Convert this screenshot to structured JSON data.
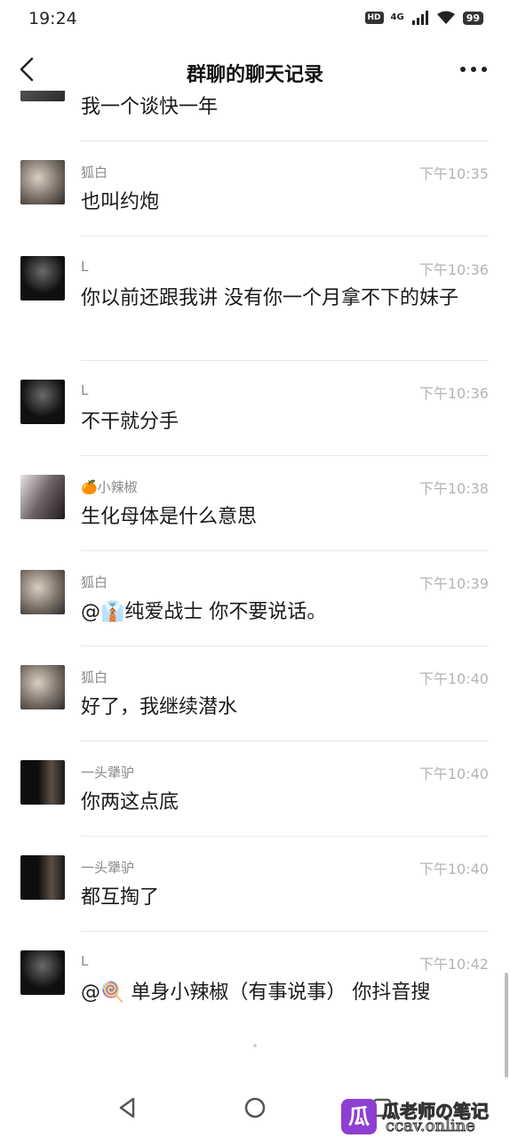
{
  "status_bar": {
    "time": "19:24",
    "hd": "HD",
    "network": "4G",
    "battery": "99"
  },
  "header": {
    "title": "群聊的聊天记录"
  },
  "partial_message": {
    "text": "我一个谈快一年"
  },
  "messages": [
    {
      "name": "狐白",
      "time": "下午10:35",
      "text": "也叫约炮"
    },
    {
      "name": "L",
      "time": "下午10:36",
      "text": "你以前还跟我讲 没有你一个月拿不下的妹子"
    },
    {
      "name": "L",
      "time": "下午10:36",
      "text": "不干就分手"
    },
    {
      "name": "🍊小辣椒",
      "time": "下午10:38",
      "text": "生化母体是什么意思"
    },
    {
      "name": "狐白",
      "time": "下午10:39",
      "text": "@👔纯爱战士 你不要说话。"
    },
    {
      "name": "狐白",
      "time": "下午10:40",
      "text": "好了，我继续潜水"
    },
    {
      "name": "一头犟驴",
      "time": "下午10:40",
      "text": "你两这点底"
    },
    {
      "name": "一头犟驴",
      "time": "下午10:40",
      "text": "都互掏了"
    },
    {
      "name": "L",
      "time": "下午10:42",
      "text": "@🍭 单身小辣椒（有事说事） 你抖音搜"
    }
  ],
  "watermark": {
    "logo": "瓜",
    "line1": "瓜老师の笔记",
    "line2": "ccav.online"
  },
  "colors": {
    "name": "#8a8a8a",
    "time": "#b4b4b4",
    "divider": "#e6e6e6"
  },
  "icons": [
    "back-arrow-icon",
    "more-dots-icon",
    "back-triangle-icon",
    "home-circle-icon",
    "recents-square-icon"
  ]
}
